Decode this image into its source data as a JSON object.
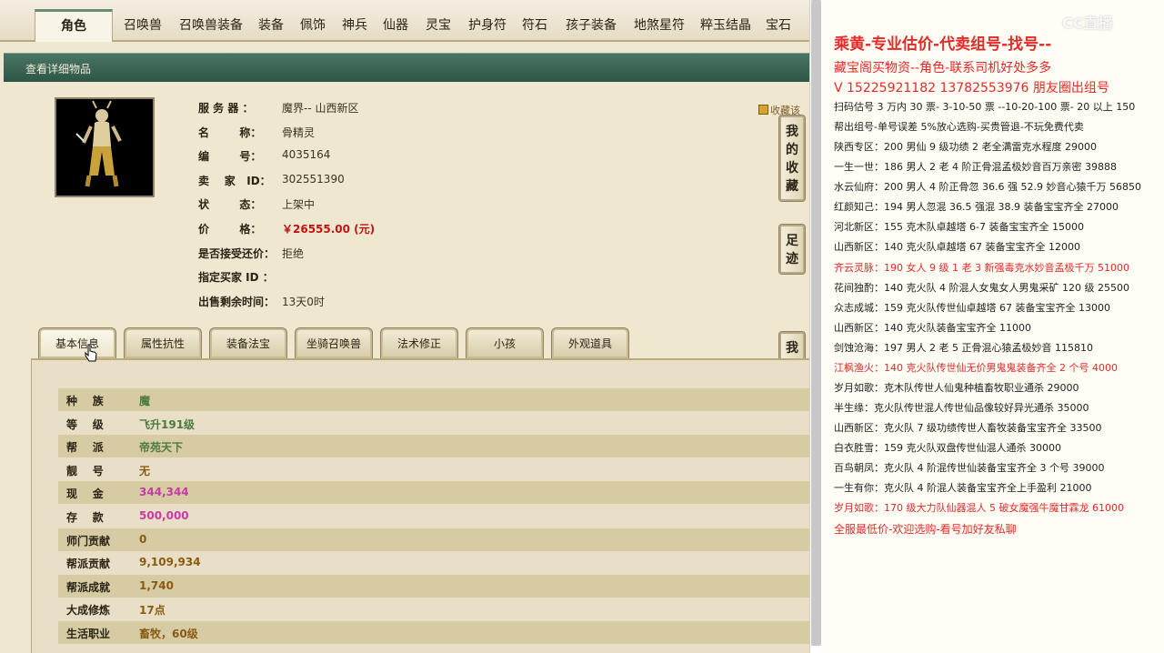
{
  "nav": {
    "tabs": [
      "角色",
      "召唤兽",
      "召唤兽装备",
      "装备",
      "佩饰",
      "神兵",
      "仙器",
      "灵宝",
      "护身符",
      "符石",
      "孩子装备",
      "地煞星符",
      "粹玉结晶",
      "宝石"
    ],
    "active": "角色"
  },
  "subhead": {
    "title": "查看详细物品"
  },
  "info": {
    "rows": [
      {
        "label": "服 务 器 ：",
        "value": "魔界-- 山西新区"
      },
      {
        "label": "名        称：",
        "value": "骨精灵"
      },
      {
        "label": "编        号：",
        "value": "4035164"
      },
      {
        "label": "卖    家   ID：",
        "value": "302551390"
      },
      {
        "label": "状        态：",
        "value": "上架中"
      },
      {
        "label": "价        格：",
        "value": "￥26555.00 (元)"
      },
      {
        "label": "是否接受还价：",
        "value": "拒绝"
      },
      {
        "label": "指定买家 ID ：",
        "value": ""
      },
      {
        "label": "出售剩余时间：",
        "value": "13天0时"
      }
    ],
    "collect_link": "收藏该"
  },
  "side_buttons": [
    {
      "label": "我的收藏"
    },
    {
      "label": "足迹"
    },
    {
      "label": "我的还价"
    }
  ],
  "subtabs": [
    "基本信息",
    "属性抗性",
    "装备法宝",
    "坐骑召唤兽",
    "法术修正",
    "小孩",
    "外观道具"
  ],
  "attributes": [
    {
      "label": "种    族",
      "value": "魔",
      "color": "#4b7a3e"
    },
    {
      "label": "等    级",
      "value": "飞升191级",
      "color": "#4b7a3e"
    },
    {
      "label": "帮    派",
      "value": "帝苑天下",
      "color": "#4b7a3e"
    },
    {
      "label": "靓    号",
      "value": "无",
      "color": "#8a5a10"
    },
    {
      "label": "现    金",
      "value": "344,344",
      "color": "#c83aa8"
    },
    {
      "label": "存    款",
      "value": "500,000",
      "color": "#c83aa8"
    },
    {
      "label": "师门贡献",
      "value": "0",
      "color": "#8a5a10"
    },
    {
      "label": "帮派贡献",
      "value": "9,109,934",
      "color": "#8a5a10"
    },
    {
      "label": "帮派成就",
      "value": "1,740",
      "color": "#8a5a10"
    },
    {
      "label": "大成修炼",
      "value": "17点",
      "color": "#8a5a10"
    },
    {
      "label": "生活职业",
      "value": "畜牧，60级",
      "color": "#8a5a10"
    }
  ],
  "ads": {
    "logo": "CC直播",
    "lines": [
      {
        "text": "乘黄-专业估价-代卖组号-找号--",
        "style": "big"
      },
      {
        "text": "藏宝阁买物资--角色-联系司机好处多多",
        "style": "mid"
      },
      {
        "text": "V 15225921182   13782553976 朋友圈出组号",
        "style": "mid"
      },
      {
        "text": "扫码估号 3 万内 30 票- 3-10-50 票  --10-20-100 票- 20 以上 150",
        "style": "norm"
      },
      {
        "text": "帮出组号-单号误差 5%放心选购-买贵管退-不玩免费代卖",
        "style": "norm"
      },
      {
        "text": "陕西专区：200 男仙 9 级功绩 2 老全满雷克水程度 29000",
        "style": "norm"
      },
      {
        "text": "一生一世：186 男人 2 老 4 阶正骨混孟极妙音百万亲密 39888",
        "style": "norm"
      },
      {
        "text": "水云仙府：200 男人 4 阶正骨忽 36.6 强 52.9 妙音心猿千万 56850",
        "style": "norm"
      },
      {
        "text": "红颜知己：194 男人忽混 36.5 强混 38.9 装备宝宝齐全 27000",
        "style": "norm"
      },
      {
        "text": "河北新区：155 克木队卓越塔 6-7 装备宝宝齐全 15000",
        "style": "norm"
      },
      {
        "text": "山西新区：140 克火队卓越塔 67 装备宝宝齐全 12000",
        "style": "norm"
      },
      {
        "text": "齐云灵脉：190 女人 9 级 1 老 3 新强毒克水妙音孟极千万 51000",
        "style": "red"
      },
      {
        "text": "花间独酌：140 克火队 4 阶混人女鬼女人男鬼采矿 120 级 25500",
        "style": "norm"
      },
      {
        "text": "众志成城：159 克火队传世仙卓越塔 67 装备宝宝齐全 13000",
        "style": "norm"
      },
      {
        "text": "山西新区：140 克火队装备宝宝齐全 11000",
        "style": "norm"
      },
      {
        "text": "剑蚀沧海：197 男人 2 老 5 正骨混心猿孟极妙音 115810",
        "style": "norm"
      },
      {
        "text": "江枫渔火：140 克火队传世仙无价男鬼鬼装备齐全 2 个号 4000",
        "style": "red"
      },
      {
        "text": "岁月如歌：克木队传世人仙鬼种植畜牧职业通杀 29000",
        "style": "norm"
      },
      {
        "text": "半生缘：克火队传世混人传世仙品像较好异光通杀 35000",
        "style": "norm"
      },
      {
        "text": "山西新区：克火队 7 级功绩传世人畜牧装备宝宝齐全 33500",
        "style": "norm"
      },
      {
        "text": "白衣胜雪：159 克火队双盘传世仙混人通杀 30000",
        "style": "norm"
      },
      {
        "text": "百鸟朝凤：克火队 4 阶混传世仙装备宝宝齐全 3 个号 39000",
        "style": "norm"
      },
      {
        "text": "一生有你：克火队 4 阶混人装备宝宝齐全上手盈利 21000",
        "style": "norm"
      },
      {
        "text": "岁月如歌：170 级大力队仙器混人 5 破女魔强牛魔甘霖龙 61000",
        "style": "red"
      },
      {
        "text": "全服最低价-欢迎选购-看号加好友私聊",
        "style": "midsmall"
      }
    ]
  }
}
